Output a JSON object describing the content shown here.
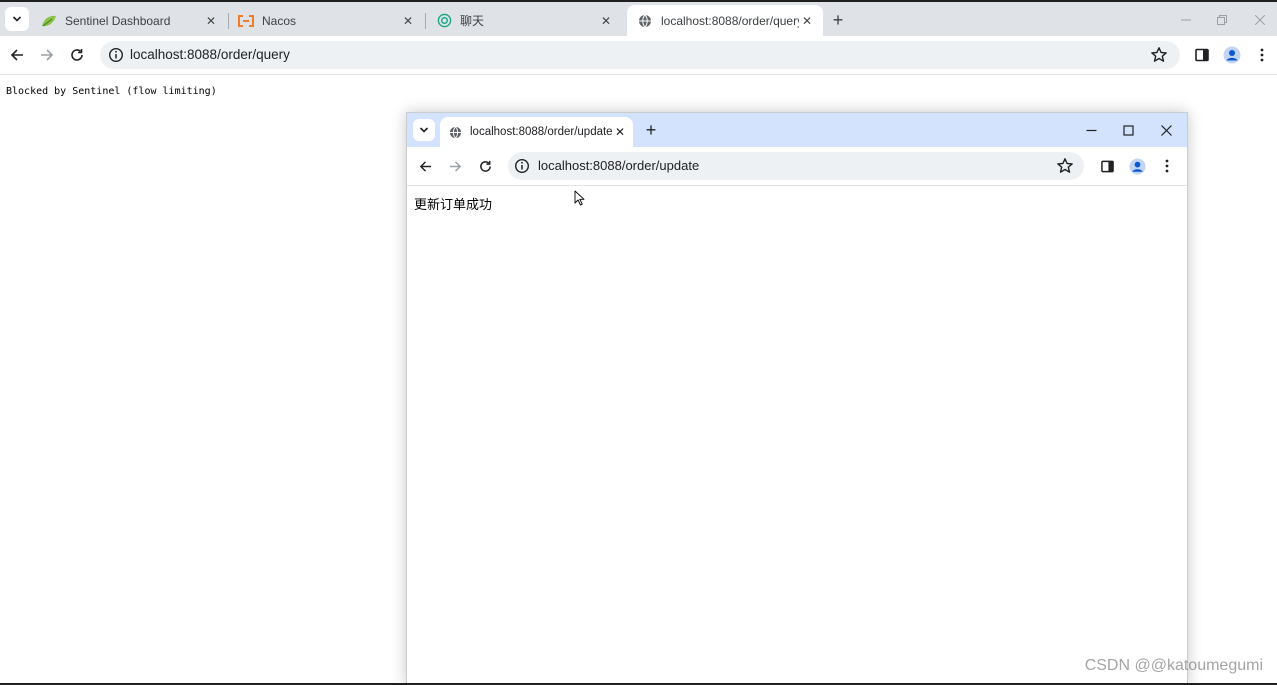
{
  "main_window": {
    "tabs": [
      {
        "title": "Sentinel Dashboard",
        "favicon": "sentinel-leaf-icon",
        "active": false
      },
      {
        "title": "Nacos",
        "favicon": "nacos-icon",
        "active": false
      },
      {
        "title": "聊天",
        "favicon": "chatgpt-icon",
        "active": false
      },
      {
        "title": "localhost:8088/order/query",
        "favicon": "globe-icon",
        "active": true
      }
    ],
    "address_bar": {
      "url": "localhost:8088/order/query"
    },
    "page_text": "Blocked by Sentinel (flow limiting)"
  },
  "popup_window": {
    "tab": {
      "title": "localhost:8088/order/update",
      "favicon": "globe-icon"
    },
    "address_bar": {
      "url": "localhost:8088/order/update"
    },
    "page_text": "更新订单成功"
  },
  "watermark": "CSDN @@katoumegumi",
  "colors": {
    "main_tabbar": "#dfe3e7",
    "popup_tabbar": "#d3e3fd",
    "omnibox": "#eef1f4",
    "profile_accent": "#0b57d0"
  }
}
